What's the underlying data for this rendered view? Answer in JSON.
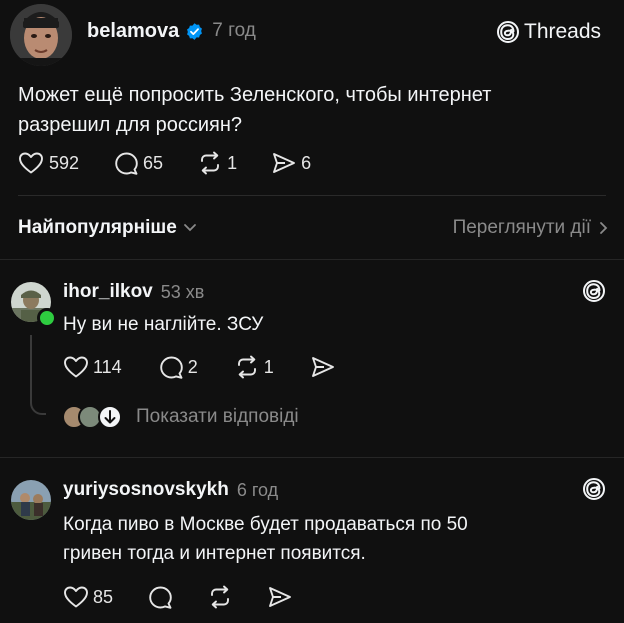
{
  "post": {
    "username": "belamova",
    "time": "7 год",
    "brand": "Threads",
    "text_line1": "Может ещё попросить Зеленского, чтобы интернет",
    "text_line2": "разрешил для россиян?",
    "likes": "592",
    "comments": "65",
    "reposts": "1",
    "shares": "6"
  },
  "sort": {
    "label": "Найпопулярніше",
    "activity_link": "Переглянути дії"
  },
  "replies": [
    {
      "username": "ihor_ilkov",
      "time": "53 хв",
      "text": "Ну ви не наглійте. ЗСУ",
      "likes": "114",
      "comments": "2",
      "reposts": "1",
      "show_replies": "Показати відповіді"
    },
    {
      "username": "yuriysosnovskykh",
      "time": "6 год",
      "text_line1": "Когда пиво в Москве будет продаваться по 50",
      "text_line2": "гривен тогда и интернет появится.",
      "likes": "85"
    }
  ],
  "colors": {
    "background": "#101010",
    "verified": "#0095f6",
    "online": "#2ecc40",
    "muted": "#8a8a8a"
  }
}
